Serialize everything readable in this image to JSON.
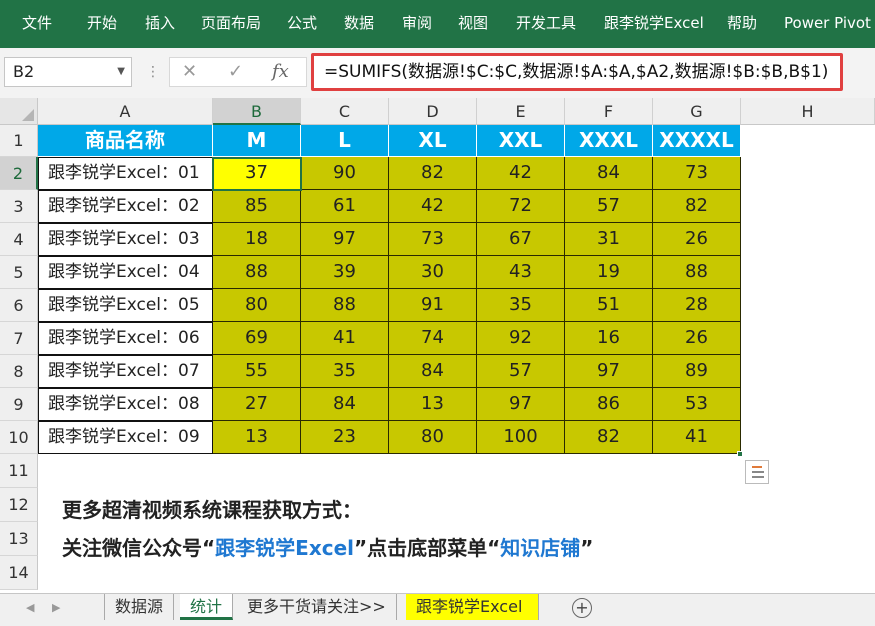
{
  "ribbon": {
    "tabs": [
      "文件",
      "开始",
      "插入",
      "页面布局",
      "公式",
      "数据",
      "审阅",
      "视图",
      "开发工具",
      "跟李锐学Excel",
      "帮助",
      "Power Pivot"
    ]
  },
  "formula_bar": {
    "name_box": "B2",
    "cancel_icon": "✕",
    "enter_icon": "✓",
    "fx_label": "fx",
    "formula": "=SUMIFS(数据源!$C:$C,数据源!$A:$A,$A2,数据源!$B:$B,B$1)"
  },
  "grid": {
    "column_headers": [
      "A",
      "B",
      "C",
      "D",
      "E",
      "F",
      "G",
      "H"
    ],
    "row_numbers": [
      "1",
      "2",
      "3",
      "4",
      "5",
      "6",
      "7",
      "8",
      "9",
      "10",
      "11",
      "12",
      "13",
      "14"
    ],
    "active_cell": "B2",
    "table_headers": [
      "商品名称",
      "M",
      "L",
      "XL",
      "XXL",
      "XXXL",
      "XXXXL"
    ],
    "rows": [
      {
        "name": "跟李锐学Excel：01",
        "values": [
          "37",
          "90",
          "82",
          "42",
          "84",
          "73"
        ]
      },
      {
        "name": "跟李锐学Excel：02",
        "values": [
          "85",
          "61",
          "42",
          "72",
          "57",
          "82"
        ]
      },
      {
        "name": "跟李锐学Excel：03",
        "values": [
          "18",
          "97",
          "73",
          "67",
          "31",
          "26"
        ]
      },
      {
        "name": "跟李锐学Excel：04",
        "values": [
          "88",
          "39",
          "30",
          "43",
          "19",
          "88"
        ]
      },
      {
        "name": "跟李锐学Excel：05",
        "values": [
          "80",
          "88",
          "91",
          "35",
          "51",
          "28"
        ]
      },
      {
        "name": "跟李锐学Excel：06",
        "values": [
          "69",
          "41",
          "74",
          "92",
          "16",
          "26"
        ]
      },
      {
        "name": "跟李锐学Excel：07",
        "values": [
          "55",
          "35",
          "84",
          "57",
          "97",
          "89"
        ]
      },
      {
        "name": "跟李锐学Excel：08",
        "values": [
          "27",
          "84",
          "13",
          "97",
          "86",
          "53"
        ]
      },
      {
        "name": "跟李锐学Excel：09",
        "values": [
          "13",
          "23",
          "80",
          "100",
          "82",
          "41"
        ]
      }
    ]
  },
  "promo": {
    "line1": "更多超清视频系统课程获取方式：",
    "line2_prefix": "关注微信公众号“",
    "line2_account": "跟李锐学Excel",
    "line2_middle": "”点击底部菜单“",
    "line2_menu": "知识店铺",
    "line2_suffix": "”"
  },
  "sheet_tabs": [
    {
      "label": "数据源",
      "active": false
    },
    {
      "label": "统计",
      "active": true
    },
    {
      "label": "更多干货请关注>>",
      "active": false
    },
    {
      "label": "跟李锐学Excel",
      "active": false,
      "highlight": "#ffff00"
    }
  ],
  "colors": {
    "excel_green": "#217346",
    "header_blue": "#00a8e8",
    "data_olive": "#c8c800",
    "active_yellow": "#ffff00",
    "formula_border_red": "#e04040",
    "promo_blue": "#1f78d1"
  }
}
